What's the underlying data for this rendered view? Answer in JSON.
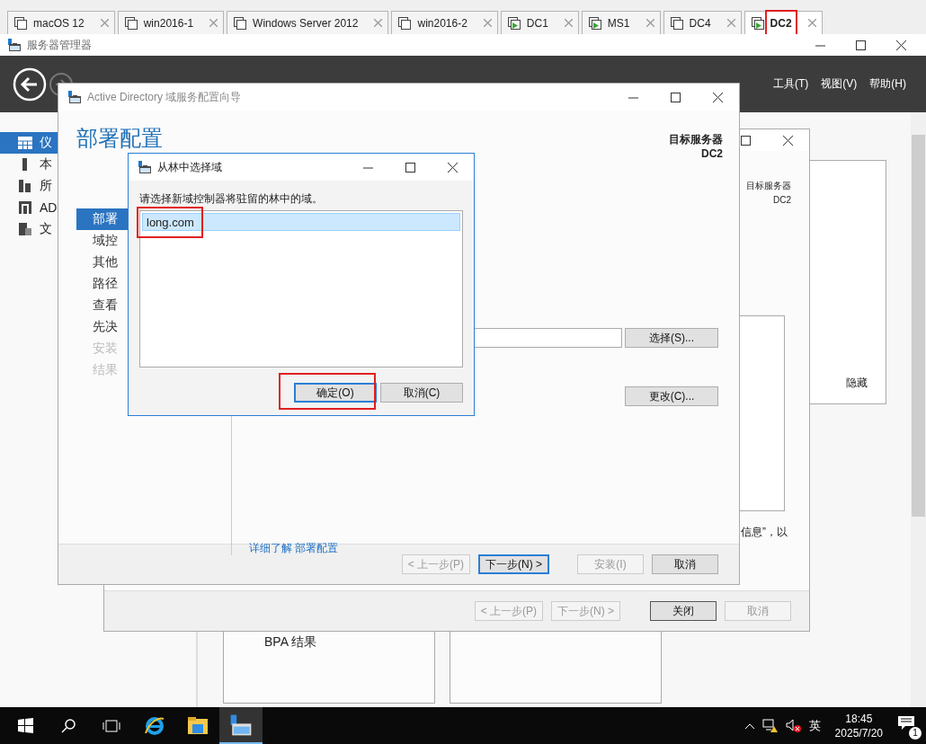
{
  "tabs": [
    {
      "label": "macOS 12",
      "kind": "stopped",
      "selected": false,
      "highlighted": false
    },
    {
      "label": "win2016-1",
      "kind": "stopped",
      "selected": false,
      "highlighted": false
    },
    {
      "label": "Windows Server 2012",
      "kind": "stopped",
      "selected": false,
      "highlighted": false
    },
    {
      "label": "win2016-2",
      "kind": "stopped",
      "selected": false,
      "highlighted": false
    },
    {
      "label": "DC1",
      "kind": "running",
      "selected": false,
      "highlighted": false
    },
    {
      "label": "MS1",
      "kind": "running",
      "selected": false,
      "highlighted": false
    },
    {
      "label": "DC4",
      "kind": "stopped",
      "selected": false,
      "highlighted": false
    },
    {
      "label": "DC2",
      "kind": "running",
      "selected": true,
      "highlighted": true
    }
  ],
  "server_manager": {
    "title": "服务器管理器",
    "menu": [
      "工具(T)",
      "视图(V)",
      "帮助(H)"
    ],
    "sidebar": [
      {
        "label": "仪",
        "kind": "dashboard",
        "selected": true
      },
      {
        "label": "本",
        "kind": "server",
        "selected": false
      },
      {
        "label": "所",
        "kind": "servers",
        "selected": false
      },
      {
        "label": "AD",
        "kind": "ad",
        "selected": false
      },
      {
        "label": "文",
        "kind": "files",
        "selected": false
      }
    ],
    "panel_text": "隐藏",
    "tile_title": "BPA 结果"
  },
  "roles_wizard": {
    "target_label": "目标服务器",
    "target_server": "DC2",
    "partial_text": "信息”，以",
    "buttons": [
      {
        "label": "< 上一步(P)",
        "disabled": true,
        "default": false
      },
      {
        "label": "下一步(N) >",
        "disabled": true,
        "default": false
      },
      {
        "label": "关闭",
        "disabled": false,
        "default": true
      },
      {
        "label": "取消",
        "disabled": true,
        "default": false
      }
    ]
  },
  "ad_wizard": {
    "title": "Active Directory 域服务配置向导",
    "heading": "部署配置",
    "target_label": "目标服务器",
    "target_server": "DC2",
    "steps": [
      {
        "label": "部署",
        "selected": true,
        "disabled": false
      },
      {
        "label": "域控",
        "selected": false,
        "disabled": false
      },
      {
        "label": "其他",
        "selected": false,
        "disabled": false
      },
      {
        "label": "路径",
        "selected": false,
        "disabled": false
      },
      {
        "label": "查看",
        "selected": false,
        "disabled": false
      },
      {
        "label": "先决",
        "selected": false,
        "disabled": false
      },
      {
        "label": "安装",
        "selected": false,
        "disabled": true
      },
      {
        "label": "结果",
        "selected": false,
        "disabled": true
      }
    ],
    "select_button": "选择(S)...",
    "change_button": "更改(C)...",
    "link": "详细了解 部署配置",
    "buttons": [
      {
        "label": "< 上一步(P)",
        "disabled": true,
        "focused": false
      },
      {
        "label": "下一步(N) >",
        "disabled": false,
        "focused": true
      },
      {
        "label": "安装(I)",
        "disabled": true,
        "focused": false
      },
      {
        "label": "取消",
        "disabled": false,
        "focused": false
      }
    ]
  },
  "domain_dialog": {
    "title": "从林中选择域",
    "prompt": "请选择新域控制器将驻留的林中的域。",
    "domains": [
      {
        "name": "long.com",
        "selected": true,
        "highlighted": true
      }
    ],
    "buttons": [
      {
        "label": "确定(O)",
        "default": true,
        "highlighted": true
      },
      {
        "label": "取消(C)",
        "default": false,
        "highlighted": false
      }
    ]
  },
  "taskbar": {
    "apps": [
      {
        "kind": "ie",
        "selected": false
      },
      {
        "kind": "explorer",
        "selected": false
      },
      {
        "kind": "server-manager",
        "selected": true
      }
    ],
    "ime": "英",
    "time": "18:45",
    "date": "2025/7/20",
    "notifications": "1"
  }
}
